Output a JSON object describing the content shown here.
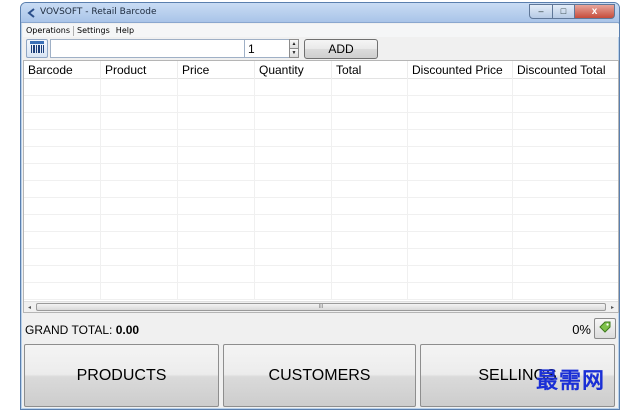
{
  "window": {
    "title": "VOVSOFT - Retail Barcode",
    "controls": {
      "minimize": "–",
      "maximize": "□",
      "close": "x"
    }
  },
  "menu": {
    "items": [
      {
        "label": "Operations"
      },
      {
        "label": "Settings"
      },
      {
        "label": "Help"
      }
    ]
  },
  "toolbar": {
    "barcode_value": "",
    "quantity_value": "1",
    "spin_up": "▲",
    "spin_down": "▼",
    "add_label": "ADD",
    "barcode_icon": "barcode-scanner-icon"
  },
  "grid": {
    "columns": [
      {
        "label": "Barcode"
      },
      {
        "label": "Product"
      },
      {
        "label": "Price"
      },
      {
        "label": "Quantity"
      },
      {
        "label": "Total"
      },
      {
        "label": "Discounted Price"
      },
      {
        "label": "Discounted Total"
      }
    ],
    "rows": [],
    "scroll_left": "◂",
    "scroll_right": "▸",
    "scroll_grip": "III"
  },
  "summary": {
    "grand_total_label": "GRAND TOTAL:",
    "grand_total_value": "0.00",
    "discount_percent": "0%",
    "discount_icon": "price-tag-icon"
  },
  "actions": {
    "products": "PRODUCTS",
    "customers": "CUSTOMERS",
    "sellings": "SELLINGS"
  },
  "watermark": "最需网",
  "colors": {
    "title_bar": "#c9dcf4",
    "close_button": "#c64c3b",
    "watermark": "#1a2fd6"
  }
}
